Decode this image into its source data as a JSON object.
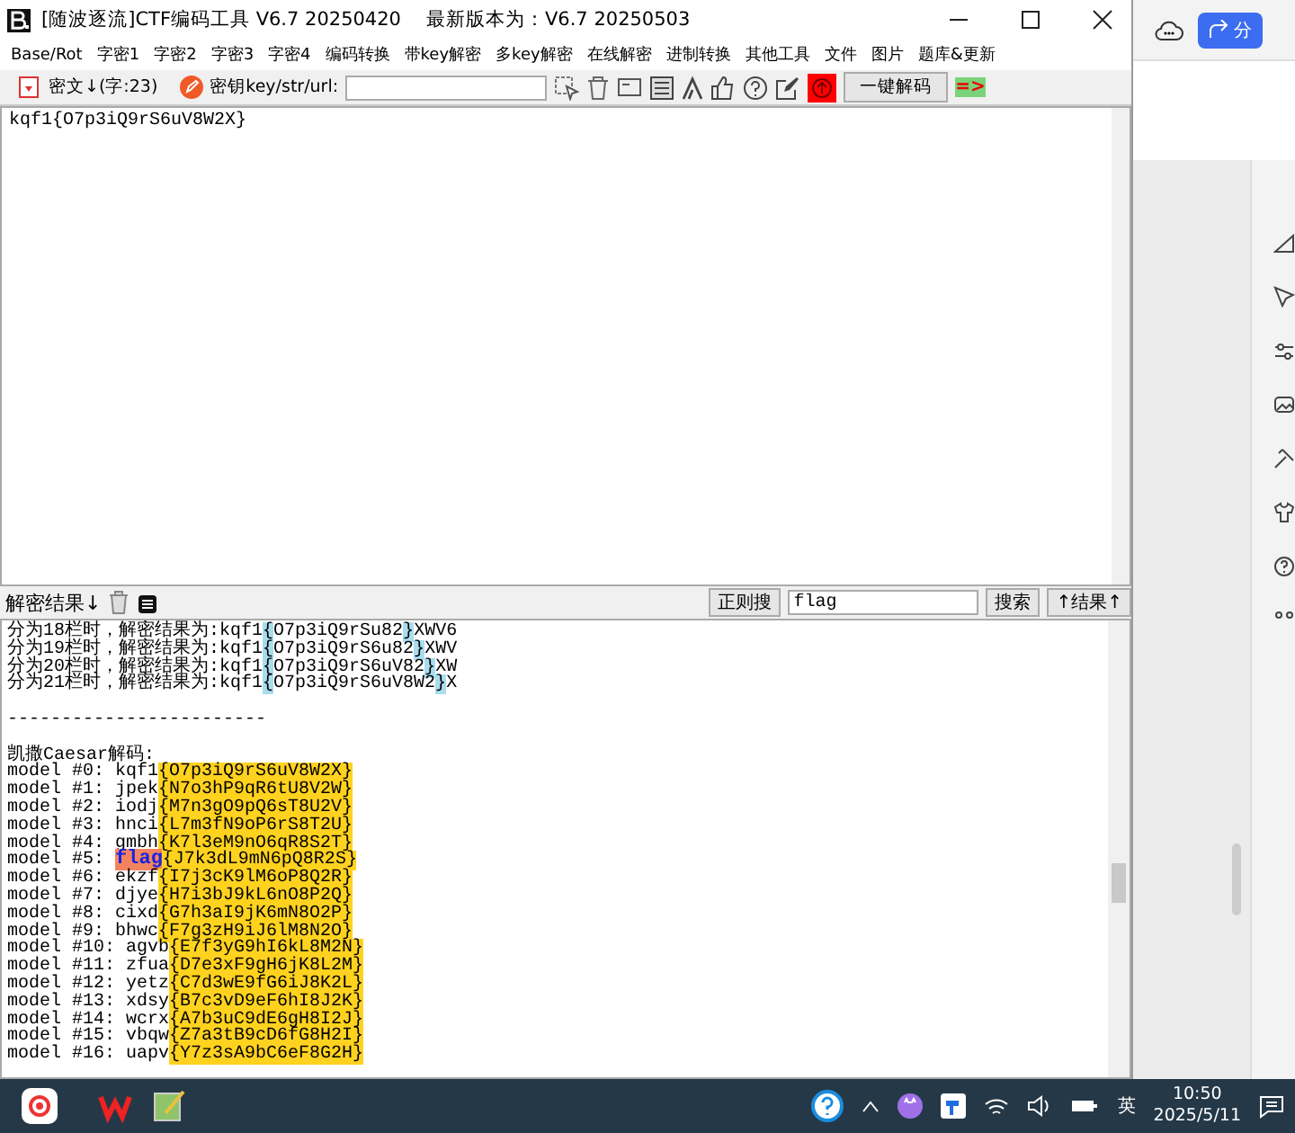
{
  "window": {
    "title": "[随波逐流]CTF编码工具 V6.7 20250420",
    "latest": "最新版本为：V6.7  20250503"
  },
  "menu": [
    "Base/Rot",
    "字密1",
    "字密2",
    "字密3",
    "字密4",
    "编码转换",
    "带key解密",
    "多key解密",
    "在线解密",
    "进制转换",
    "其他工具",
    "文件",
    "图片",
    "题库&更新"
  ],
  "toolbar": {
    "cipher_label": "密文↓(字:23)",
    "key_label": "密钥key/str/url:",
    "decode_button": "一键解码",
    "arrow": "=>"
  },
  "input": {
    "value": "kqf1{O7p3iQ9rS6uV8W2X}"
  },
  "result_bar": {
    "label": "解密结果↓",
    "regex_button": "正则搜",
    "search": {
      "value": "flag"
    },
    "search_button": "搜索",
    "result_button": "↑结果↑"
  },
  "results": [
    {
      "kind": "text",
      "segments": [
        {
          "kind": "plain",
          "text": "分为18栏时，解密结果为:kqf1"
        },
        {
          "kind": "mark",
          "color": "#a9dcef",
          "text": "{"
        },
        {
          "kind": "plain",
          "text": "O7p3iQ9rSu82"
        },
        {
          "kind": "mark",
          "color": "#a9dcef",
          "text": "}"
        },
        {
          "kind": "plain",
          "text": "XWV6"
        }
      ]
    },
    {
      "kind": "text",
      "segments": [
        {
          "kind": "plain",
          "text": "分为19栏时，解密结果为:kqf1"
        },
        {
          "kind": "mark",
          "color": "#a9dcef",
          "text": "{"
        },
        {
          "kind": "plain",
          "text": "O7p3iQ9rS6u82"
        },
        {
          "kind": "mark",
          "color": "#a9dcef",
          "text": "}"
        },
        {
          "kind": "plain",
          "text": "XWV"
        }
      ]
    },
    {
      "kind": "text",
      "segments": [
        {
          "kind": "plain",
          "text": "分为20栏时，解密结果为:kqf1"
        },
        {
          "kind": "mark",
          "color": "#a9dcef",
          "text": "{"
        },
        {
          "kind": "plain",
          "text": "O7p3iQ9rS6uV82"
        },
        {
          "kind": "mark",
          "color": "#a9dcef",
          "text": "}"
        },
        {
          "kind": "plain",
          "text": "XW"
        }
      ]
    },
    {
      "kind": "text",
      "segments": [
        {
          "kind": "plain",
          "text": "分为21栏时，解密结果为:kqf1"
        },
        {
          "kind": "mark",
          "color": "#a9dcef",
          "text": "{"
        },
        {
          "kind": "plain",
          "text": "O7p3iQ9rS6uV8W2"
        },
        {
          "kind": "mark",
          "color": "#a9dcef",
          "text": "}"
        },
        {
          "kind": "plain",
          "text": "X"
        }
      ]
    },
    {
      "kind": "blank"
    },
    {
      "kind": "text",
      "segments": [
        {
          "kind": "plain",
          "text": "------------------------"
        }
      ]
    },
    {
      "kind": "blank"
    },
    {
      "kind": "text",
      "segments": [
        {
          "kind": "plain",
          "text": "凯撒Caesar解码:"
        }
      ]
    },
    {
      "kind": "text",
      "segments": [
        {
          "kind": "plain",
          "text": "model #0: kqf1"
        },
        {
          "kind": "mark",
          "color": "#ffd21f",
          "text": "{O7p3iQ9rS6uV8W2X}"
        }
      ]
    },
    {
      "kind": "text",
      "segments": [
        {
          "kind": "plain",
          "text": "model #1: jpek"
        },
        {
          "kind": "mark",
          "color": "#ffd21f",
          "text": "{N7o3hP9qR6tU8V2W}"
        }
      ]
    },
    {
      "kind": "text",
      "segments": [
        {
          "kind": "plain",
          "text": "model #2: iodj"
        },
        {
          "kind": "mark",
          "color": "#ffd21f",
          "text": "{M7n3gO9pQ6sT8U2V}"
        }
      ]
    },
    {
      "kind": "text",
      "segments": [
        {
          "kind": "plain",
          "text": "model #3: hnci"
        },
        {
          "kind": "mark",
          "color": "#ffd21f",
          "text": "{L7m3fN9oP6rS8T2U}"
        }
      ]
    },
    {
      "kind": "text",
      "segments": [
        {
          "kind": "plain",
          "text": "model #4: gmbh"
        },
        {
          "kind": "mark",
          "color": "#ffd21f",
          "text": "{K7l3eM9nO6qR8S2T}"
        }
      ]
    },
    {
      "kind": "text",
      "segments": [
        {
          "kind": "plain",
          "text": "model #5: "
        },
        {
          "kind": "hit",
          "color": "#f4845f",
          "text": "flag"
        },
        {
          "kind": "mark",
          "color": "#ffd21f",
          "text": "{J7k3dL9mN6pQ8R2S}"
        }
      ]
    },
    {
      "kind": "text",
      "segments": [
        {
          "kind": "plain",
          "text": "model #6: ekzf"
        },
        {
          "kind": "mark",
          "color": "#ffd21f",
          "text": "{I7j3cK9lM6oP8Q2R}"
        }
      ]
    },
    {
      "kind": "text",
      "segments": [
        {
          "kind": "plain",
          "text": "model #7: djye"
        },
        {
          "kind": "mark",
          "color": "#ffd21f",
          "text": "{H7i3bJ9kL6nO8P2Q}"
        }
      ]
    },
    {
      "kind": "text",
      "segments": [
        {
          "kind": "plain",
          "text": "model #8: cixd"
        },
        {
          "kind": "mark",
          "color": "#ffd21f",
          "text": "{G7h3aI9jK6mN8O2P}"
        }
      ]
    },
    {
      "kind": "text",
      "segments": [
        {
          "kind": "plain",
          "text": "model #9: bhwc"
        },
        {
          "kind": "mark",
          "color": "#ffd21f",
          "text": "{F7g3zH9iJ6lM8N2O}"
        }
      ]
    },
    {
      "kind": "text",
      "segments": [
        {
          "kind": "plain",
          "text": "model #10: agvb"
        },
        {
          "kind": "mark",
          "color": "#ffd21f",
          "text": "{E7f3yG9hI6kL8M2N}"
        }
      ]
    },
    {
      "kind": "text",
      "segments": [
        {
          "kind": "plain",
          "text": "model #11: zfua"
        },
        {
          "kind": "mark",
          "color": "#ffd21f",
          "text": "{D7e3xF9gH6jK8L2M}"
        }
      ]
    },
    {
      "kind": "text",
      "segments": [
        {
          "kind": "plain",
          "text": "model #12: yetz"
        },
        {
          "kind": "mark",
          "color": "#ffd21f",
          "text": "{C7d3wE9fG6iJ8K2L}"
        }
      ]
    },
    {
      "kind": "text",
      "segments": [
        {
          "kind": "plain",
          "text": "model #13: xdsy"
        },
        {
          "kind": "mark",
          "color": "#ffd21f",
          "text": "{B7c3vD9eF6hI8J2K}"
        }
      ]
    },
    {
      "kind": "text",
      "segments": [
        {
          "kind": "plain",
          "text": "model #14: wcrx"
        },
        {
          "kind": "mark",
          "color": "#ffd21f",
          "text": "{A7b3uC9dE6gH8I2J}"
        }
      ]
    },
    {
      "kind": "text",
      "segments": [
        {
          "kind": "plain",
          "text": "model #15: vbqw"
        },
        {
          "kind": "mark",
          "color": "#ffd21f",
          "text": "{Z7a3tB9cD6fG8H2I}"
        }
      ]
    },
    {
      "kind": "text",
      "segments": [
        {
          "kind": "plain",
          "text": "model #16: uapv"
        },
        {
          "kind": "mark",
          "color": "#ffd21f",
          "text": "{Y7z3sA9bC6eF8G2H}"
        }
      ]
    }
  ],
  "side_app": {
    "share_button": "分"
  },
  "taskbar": {
    "ime": "英",
    "time": "10:50",
    "date": "2025/5/11"
  }
}
